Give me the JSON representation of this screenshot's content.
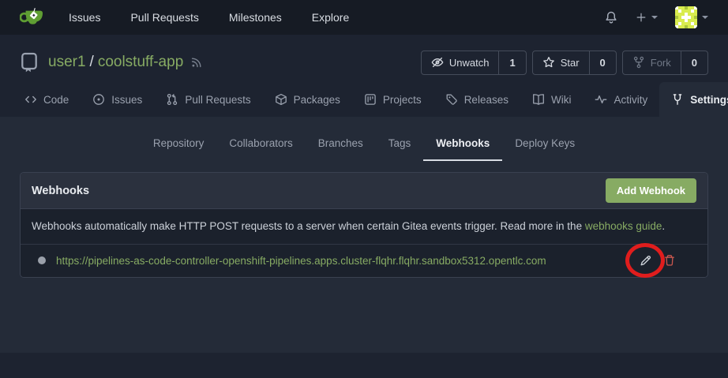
{
  "colors": {
    "accent_green": "#87ab63",
    "button_green": "#87ab63",
    "annotation_red": "#e01d1d",
    "trash_red": "#c9574e",
    "topnav_bg": "#161b24",
    "header_bg": "#1d2330",
    "content_bg": "#242b38",
    "panel_body_bg": "#1b212c",
    "panel_header_bg": "#2b313e"
  },
  "icons": [
    "gitea-logo",
    "bell-icon",
    "plus-icon",
    "caret-down-icon",
    "avatar-identicon",
    "repo-book-icon",
    "rss-icon",
    "eye-slash-icon",
    "star-icon",
    "fork-icon",
    "code-icon",
    "issue-icon",
    "pull-request-icon",
    "package-icon",
    "project-icon",
    "tag-icon",
    "wiki-book-icon",
    "activity-icon",
    "tools-icon",
    "pencil-icon",
    "trash-icon",
    "webhook-status-dot"
  ],
  "topnav": {
    "items": [
      {
        "label": "Issues"
      },
      {
        "label": "Pull Requests"
      },
      {
        "label": "Milestones"
      },
      {
        "label": "Explore"
      }
    ]
  },
  "repo_header": {
    "owner": "user1",
    "separator": "/",
    "repo_name": "coolstuff-app",
    "actions": {
      "unwatch_label": "Unwatch",
      "unwatch_count": "1",
      "star_label": "Star",
      "star_count": "0",
      "fork_label": "Fork",
      "fork_count": "0"
    }
  },
  "repo_tabs": [
    {
      "label": "Code"
    },
    {
      "label": "Issues"
    },
    {
      "label": "Pull Requests"
    },
    {
      "label": "Packages"
    },
    {
      "label": "Projects"
    },
    {
      "label": "Releases"
    },
    {
      "label": "Wiki"
    },
    {
      "label": "Activity"
    },
    {
      "label": "Settings",
      "active": true
    }
  ],
  "settings_tabs": [
    {
      "label": "Repository"
    },
    {
      "label": "Collaborators"
    },
    {
      "label": "Branches"
    },
    {
      "label": "Tags"
    },
    {
      "label": "Webhooks",
      "active": true
    },
    {
      "label": "Deploy Keys"
    }
  ],
  "webhooks_panel": {
    "title": "Webhooks",
    "add_button_label": "Add Webhook",
    "description_text": "Webhooks automatically make HTTP POST requests to a server when certain Gitea events trigger. Read more in the ",
    "description_link": "webhooks guide",
    "description_suffix": ".",
    "webhooks": [
      {
        "url": "https://pipelines-as-code-controller-openshift-pipelines.apps.cluster-flqhr.flqhr.sandbox5312.opentlc.com"
      }
    ]
  }
}
